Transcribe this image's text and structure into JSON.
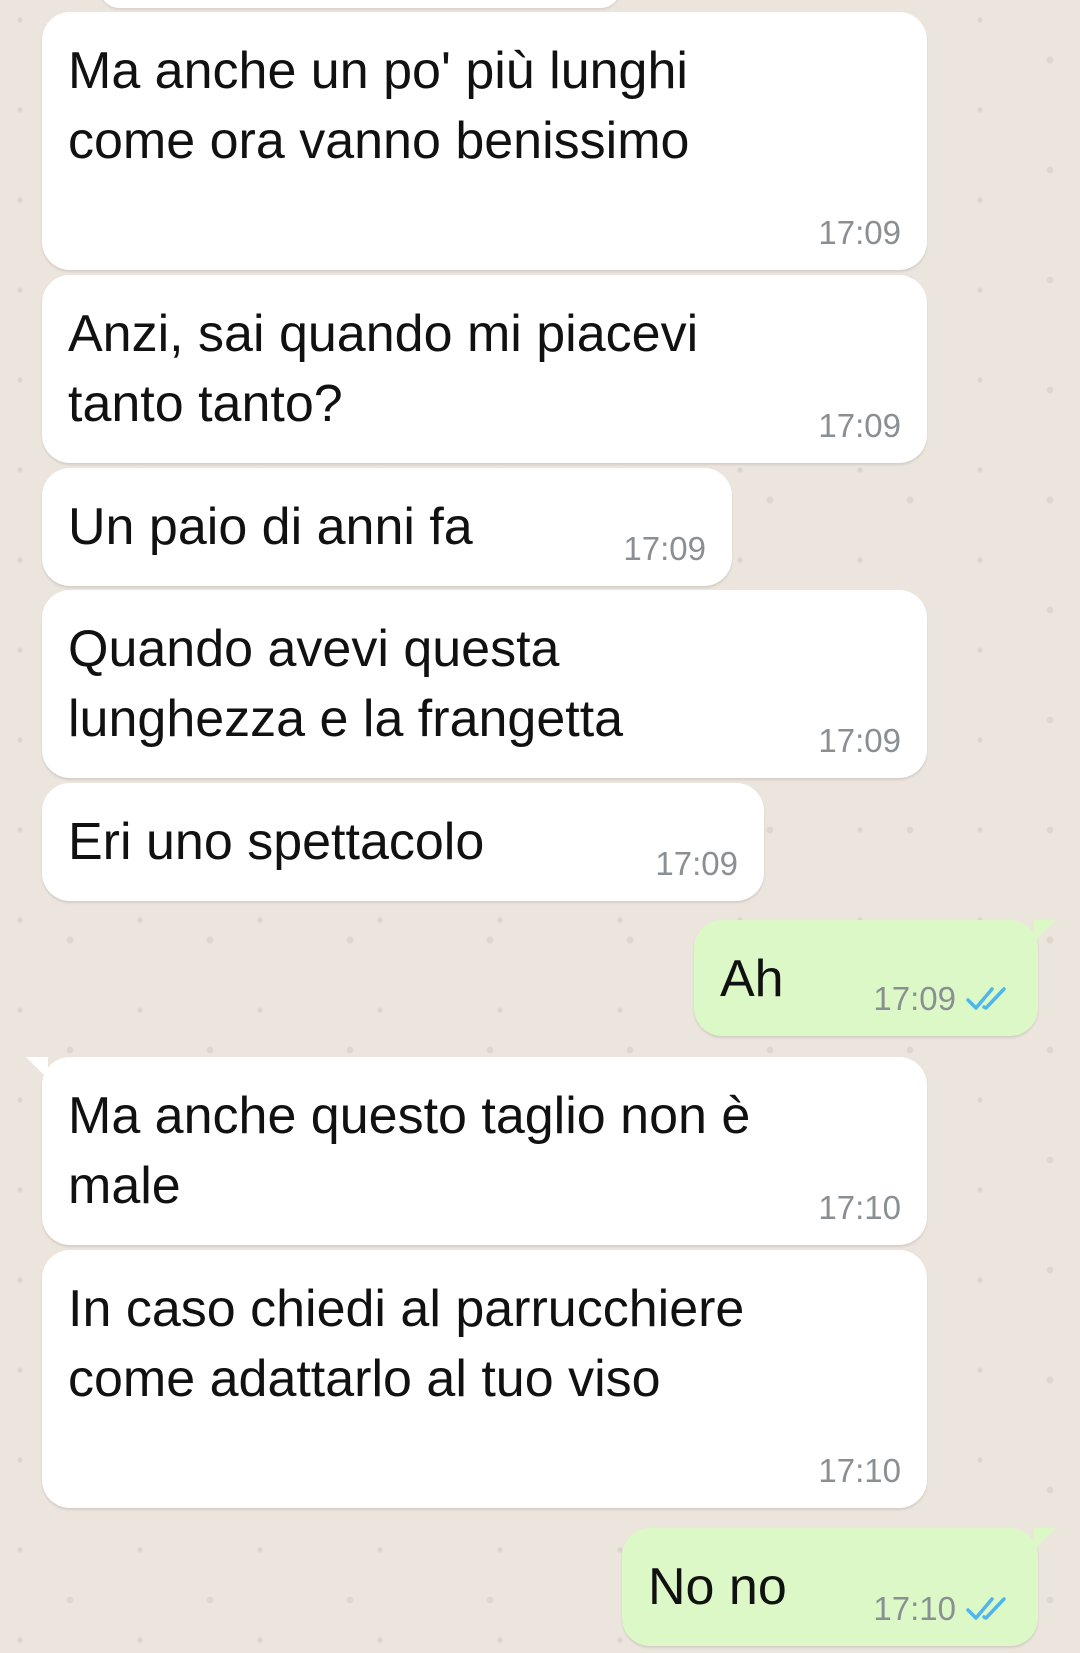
{
  "messages": [
    {
      "text": "Ma anche un po' più lunghi\ncome ora vanno benissimo",
      "time": "17:09",
      "direction": "in"
    },
    {
      "text": "Anzi, sai quando mi piacevi\ntanto tanto?",
      "time": "17:09",
      "direction": "in"
    },
    {
      "text": "Un paio di anni fa",
      "time": "17:09",
      "direction": "in"
    },
    {
      "text": "Quando avevi questa\nlunghezza e la frangetta",
      "time": "17:09",
      "direction": "in"
    },
    {
      "text": "Eri uno spettacolo",
      "time": "17:09",
      "direction": "in"
    },
    {
      "text": "Ah",
      "time": "17:09",
      "direction": "out",
      "status_icon": "double-check-icon"
    },
    {
      "text": "Ma anche questo taglio non è\nmale",
      "time": "17:10",
      "direction": "in"
    },
    {
      "text": "In caso chiedi al parrucchiere\ncome adattarlo al tuo viso",
      "time": "17:10",
      "direction": "in"
    },
    {
      "text": "No no",
      "time": "17:10",
      "direction": "out",
      "status_icon": "double-check-icon"
    }
  ],
  "colors": {
    "chat_background": "#ece5dd",
    "incoming_bubble": "#ffffff",
    "outgoing_bubble": "#dcf8c6",
    "timestamp": "#8a8f93",
    "read_tick": "#4fb6ec"
  }
}
